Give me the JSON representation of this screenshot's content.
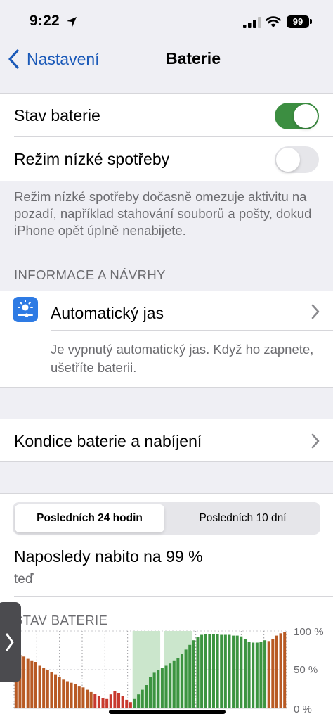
{
  "status_bar": {
    "time": "9:22",
    "battery_level": "99"
  },
  "nav": {
    "back_label": "Nastavení",
    "title": "Baterie"
  },
  "settings": {
    "battery_percentage": {
      "label": "Stav baterie",
      "enabled": true
    },
    "low_power_mode": {
      "label": "Režim nízké spotřeby",
      "enabled": false
    },
    "low_power_footnote": "Režim nízké spotřeby dočasně omezuje aktivitu na pozadí, například stahování souborů a pošty, dokud iPhone opět úplně nenabijete."
  },
  "insights": {
    "header": "INFORMACE A NÁVRHY",
    "auto_brightness": {
      "title": "Automatický jas",
      "description": "Je vypnutý automatický jas. Když ho zapnete, ušetříte baterii."
    }
  },
  "battery_health": {
    "label": "Kondice baterie a nabíjení"
  },
  "usage": {
    "tabs": [
      {
        "label": "Posledních 24 hodin",
        "selected": true
      },
      {
        "label": "Posledních 10 dní",
        "selected": false
      }
    ],
    "last_charged_title": "Naposledy nabito na 99 %",
    "last_charged_time": "teď",
    "chart_header": "STAV BATERIE"
  },
  "chart_data": {
    "type": "bar",
    "title": "STAV BATERIE",
    "y_ticks": [
      "100 %",
      "50 %",
      "0 %"
    ],
    "ylim": [
      0,
      100
    ],
    "grid": true,
    "series_colors": {
      "discharging": "#b85a24",
      "low": "#c8392e",
      "charging": "#3c9440",
      "charging_band": "#cbe6cc"
    },
    "bars": [
      {
        "v": 70,
        "s": "d"
      },
      {
        "v": 69,
        "s": "d"
      },
      {
        "v": 67,
        "s": "d"
      },
      {
        "v": 64,
        "s": "d"
      },
      {
        "v": 62,
        "s": "d"
      },
      {
        "v": 60,
        "s": "d"
      },
      {
        "v": 55,
        "s": "d"
      },
      {
        "v": 52,
        "s": "d"
      },
      {
        "v": 50,
        "s": "d"
      },
      {
        "v": 47,
        "s": "d"
      },
      {
        "v": 44,
        "s": "d"
      },
      {
        "v": 40,
        "s": "d"
      },
      {
        "v": 37,
        "s": "d"
      },
      {
        "v": 35,
        "s": "d"
      },
      {
        "v": 33,
        "s": "d"
      },
      {
        "v": 31,
        "s": "d"
      },
      {
        "v": 29,
        "s": "d"
      },
      {
        "v": 27,
        "s": "d"
      },
      {
        "v": 24,
        "s": "d"
      },
      {
        "v": 21,
        "s": "d"
      },
      {
        "v": 19,
        "s": "l"
      },
      {
        "v": 16,
        "s": "l"
      },
      {
        "v": 13,
        "s": "l"
      },
      {
        "v": 12,
        "s": "l"
      },
      {
        "v": 18,
        "s": "l"
      },
      {
        "v": 22,
        "s": "l"
      },
      {
        "v": 20,
        "s": "l"
      },
      {
        "v": 16,
        "s": "l"
      },
      {
        "v": 11,
        "s": "l"
      },
      {
        "v": 8,
        "s": "l"
      },
      {
        "v": 12,
        "s": "c"
      },
      {
        "v": 18,
        "s": "c"
      },
      {
        "v": 24,
        "s": "c"
      },
      {
        "v": 30,
        "s": "c"
      },
      {
        "v": 40,
        "s": "c"
      },
      {
        "v": 46,
        "s": "c"
      },
      {
        "v": 50,
        "s": "c"
      },
      {
        "v": 52,
        "s": "c"
      },
      {
        "v": 55,
        "s": "c"
      },
      {
        "v": 58,
        "s": "c"
      },
      {
        "v": 62,
        "s": "c"
      },
      {
        "v": 65,
        "s": "c"
      },
      {
        "v": 70,
        "s": "c"
      },
      {
        "v": 76,
        "s": "c"
      },
      {
        "v": 82,
        "s": "c"
      },
      {
        "v": 88,
        "s": "c"
      },
      {
        "v": 92,
        "s": "c"
      },
      {
        "v": 95,
        "s": "c"
      },
      {
        "v": 96,
        "s": "c"
      },
      {
        "v": 96,
        "s": "c"
      },
      {
        "v": 96,
        "s": "c"
      },
      {
        "v": 96,
        "s": "c"
      },
      {
        "v": 95,
        "s": "c"
      },
      {
        "v": 95,
        "s": "c"
      },
      {
        "v": 95,
        "s": "c"
      },
      {
        "v": 94,
        "s": "c"
      },
      {
        "v": 94,
        "s": "c"
      },
      {
        "v": 93,
        "s": "c"
      },
      {
        "v": 90,
        "s": "c"
      },
      {
        "v": 86,
        "s": "c"
      },
      {
        "v": 85,
        "s": "c"
      },
      {
        "v": 85,
        "s": "c"
      },
      {
        "v": 86,
        "s": "c"
      },
      {
        "v": 88,
        "s": "c"
      },
      {
        "v": 87,
        "s": "d"
      },
      {
        "v": 90,
        "s": "d"
      },
      {
        "v": 94,
        "s": "d"
      },
      {
        "v": 97,
        "s": "d"
      },
      {
        "v": 99,
        "s": "d"
      }
    ],
    "charging_spans": [
      [
        30,
        37
      ],
      [
        38,
        45
      ]
    ]
  }
}
